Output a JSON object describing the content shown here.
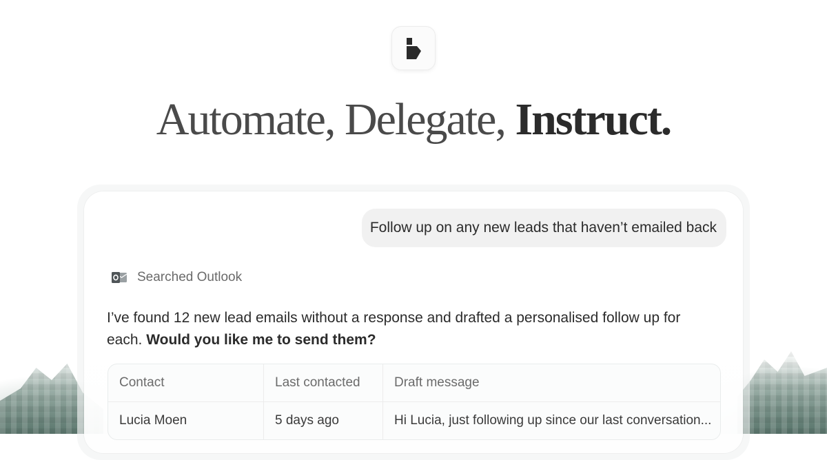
{
  "headline": {
    "part1": "Automate, Delegate, ",
    "part2": "Instruct."
  },
  "icons": {
    "logo": "brand-logo-icon",
    "tool": "outlook-icon"
  },
  "chat": {
    "user_message": "Follow up on any new leads that haven’t emailed back",
    "tool_status": "Searched Outlook",
    "assistant_text": "I’ve found 12 new lead emails without a response and drafted a personalised follow up for each. ",
    "assistant_question": "Would you like me to send them?"
  },
  "table": {
    "headers": [
      "Contact",
      "Last contacted",
      "Draft message"
    ],
    "rows": [
      [
        "Lucia Moen",
        "5 days ago",
        "Hi Lucia, just following up since our last conversation..."
      ]
    ]
  },
  "colors": {
    "background": "#ffffff",
    "bubble": "#f1f1f1",
    "text": "#2b2b2b",
    "muted": "#6a6a6a",
    "forest": "#5c7c70"
  }
}
